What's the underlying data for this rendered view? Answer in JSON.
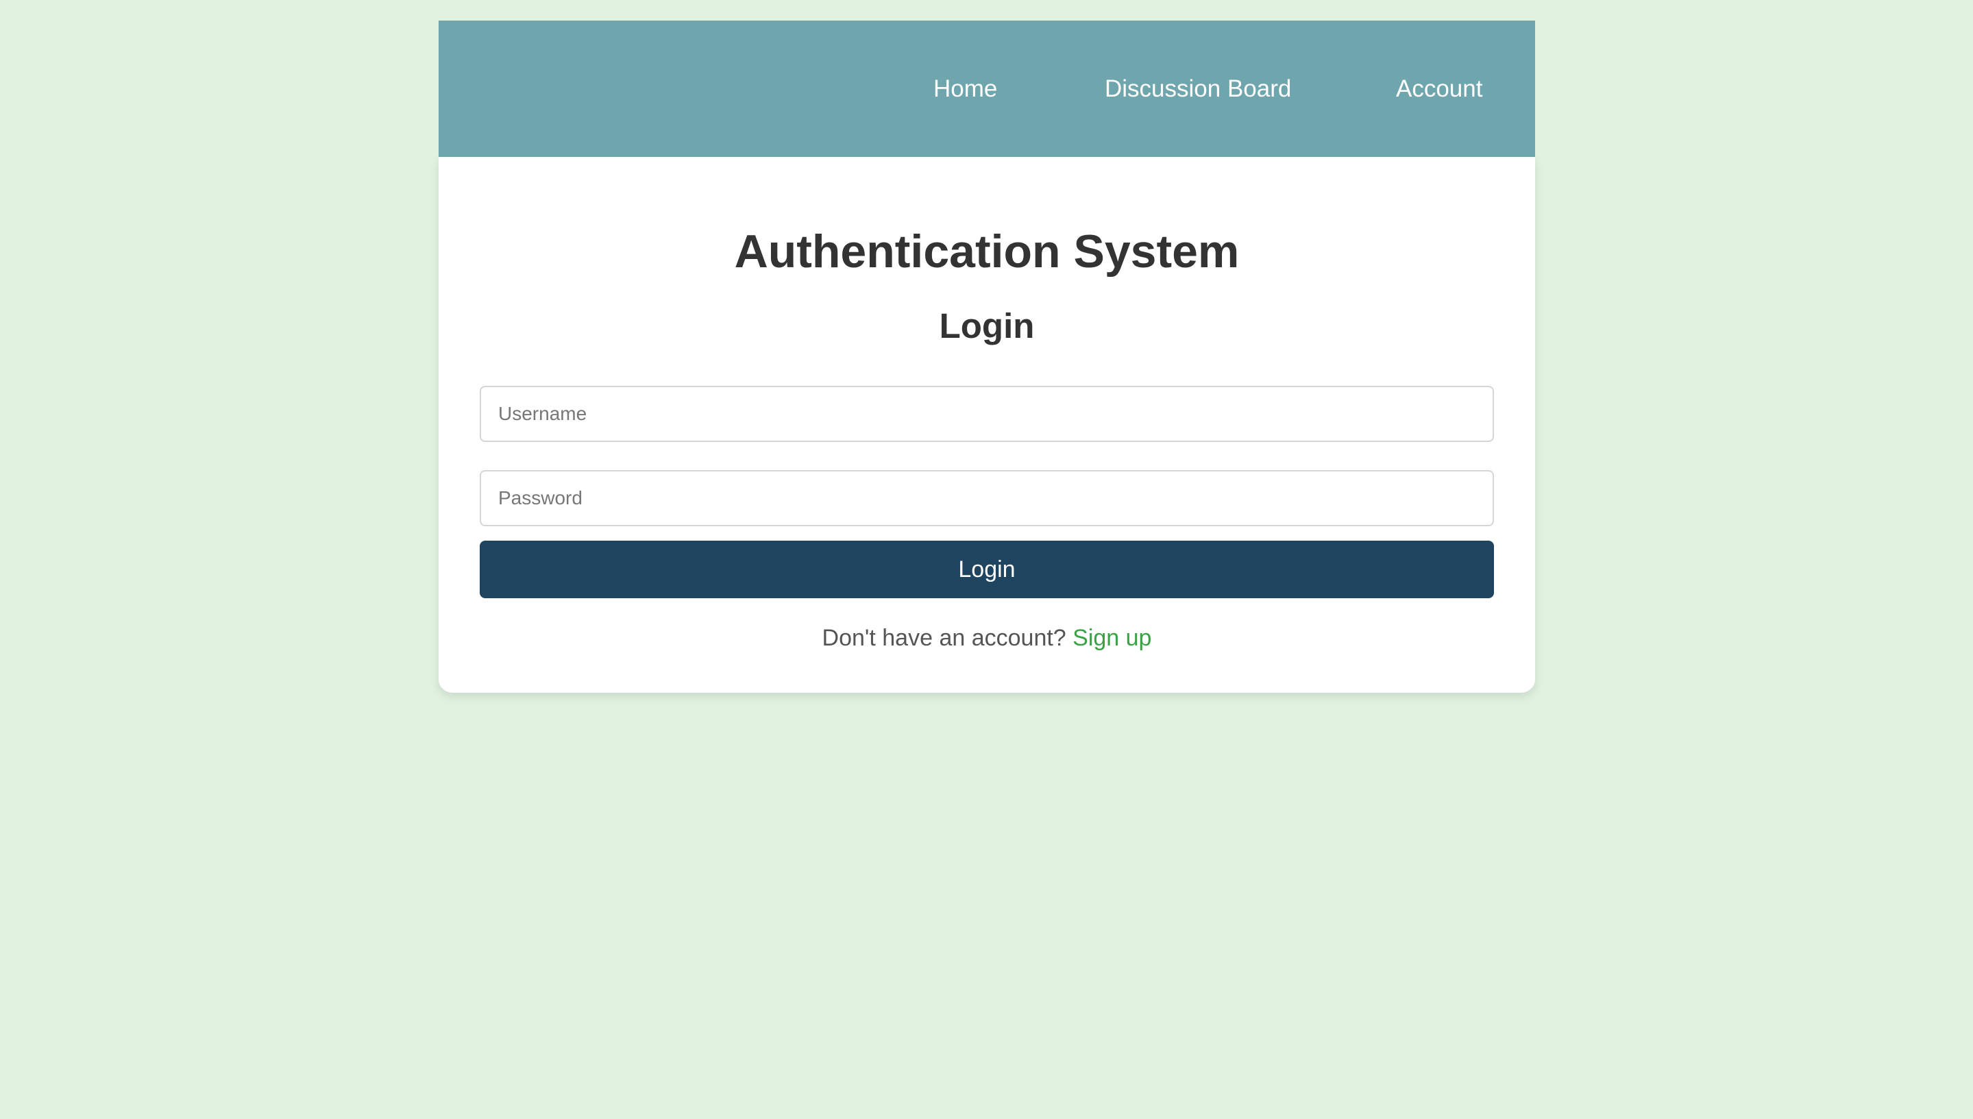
{
  "nav": {
    "items": [
      {
        "label": "Home"
      },
      {
        "label": "Discussion Board"
      },
      {
        "label": "Account"
      }
    ]
  },
  "card": {
    "title": "Authentication System",
    "subtitle": "Login",
    "username_placeholder": "Username",
    "username_value": "",
    "password_placeholder": "Password",
    "password_value": "",
    "login_label": "Login",
    "signup_prompt": "Don't have an account?",
    "signup_link": "Sign up"
  },
  "colors": {
    "background": "#e1f2e0",
    "navbar": "#6fa6ae",
    "button": "#1e4460",
    "link": "#3aa245"
  }
}
